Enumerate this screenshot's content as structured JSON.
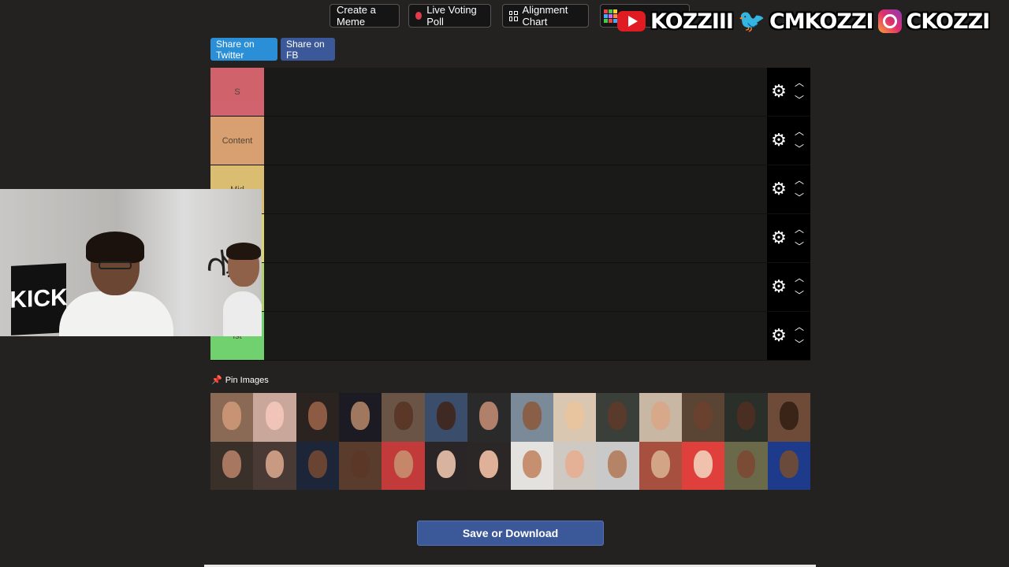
{
  "toolbar": {
    "create_meme": "Create a Meme",
    "live_poll": "Live Voting Poll",
    "alignment_chart": "Alignment Chart"
  },
  "share": {
    "twitter": "Share on Twitter",
    "fb": "Share on FB"
  },
  "tiers": [
    {
      "label": "S",
      "color": "#ef6e7a"
    },
    {
      "label": "Content",
      "color": "#f8b67f"
    },
    {
      "label": "Mid",
      "color": "#fbd97f"
    },
    {
      "label": "",
      "color": "#fbf37e"
    },
    {
      "label": "",
      "color": "#c9f27c"
    },
    {
      "label": "ist",
      "color": "#7ff07c"
    }
  ],
  "social": {
    "youtube": "KOZZIII",
    "twitter": "CMKOZZI",
    "instagram": "CKOZZI"
  },
  "pin_images": "Pin Images",
  "save_button": "Save or Download",
  "thumb_colors": [
    [
      "#8a6a55",
      "#c9a79a",
      "#2b2320",
      "#1c1a22",
      "#6a5446",
      "#3a4d6a",
      "#2a2a2a",
      "#7a8a99",
      "#d9c7b2",
      "#3a3f3a",
      "#c7b7a3",
      "#5a4434",
      "#2a2f2a",
      "#6e4a38"
    ],
    [
      "#3a302a",
      "#4a3a35",
      "#1c2638",
      "#5a3c2c",
      "#c23a3a",
      "#2a2628",
      "#2b2727",
      "#e4e2df",
      "#cfc9c4",
      "#c9c9c9",
      "#a85040",
      "#e0403c",
      "#6a6a4a",
      "#1e3a8a"
    ]
  ],
  "face_colors": [
    [
      "#c89274",
      "#f0c4b8",
      "#8d5a44",
      "#a0775f",
      "#5a3726",
      "#3e2a22",
      "#b0806a",
      "#8a5f47",
      "#e8c59f",
      "#5a3a2a",
      "#d7a98a",
      "#6a412f",
      "#4b2e22",
      "#3a2418"
    ],
    [
      "#a87760",
      "#c99a82",
      "#6a4433",
      "#5a3726",
      "#c5866a",
      "#d8b39d",
      "#e0b199",
      "#c58f70",
      "#e4b096",
      "#b58467",
      "#d3a587",
      "#f0c1ad",
      "#7a4b35",
      "#6a4a3a"
    ]
  ]
}
